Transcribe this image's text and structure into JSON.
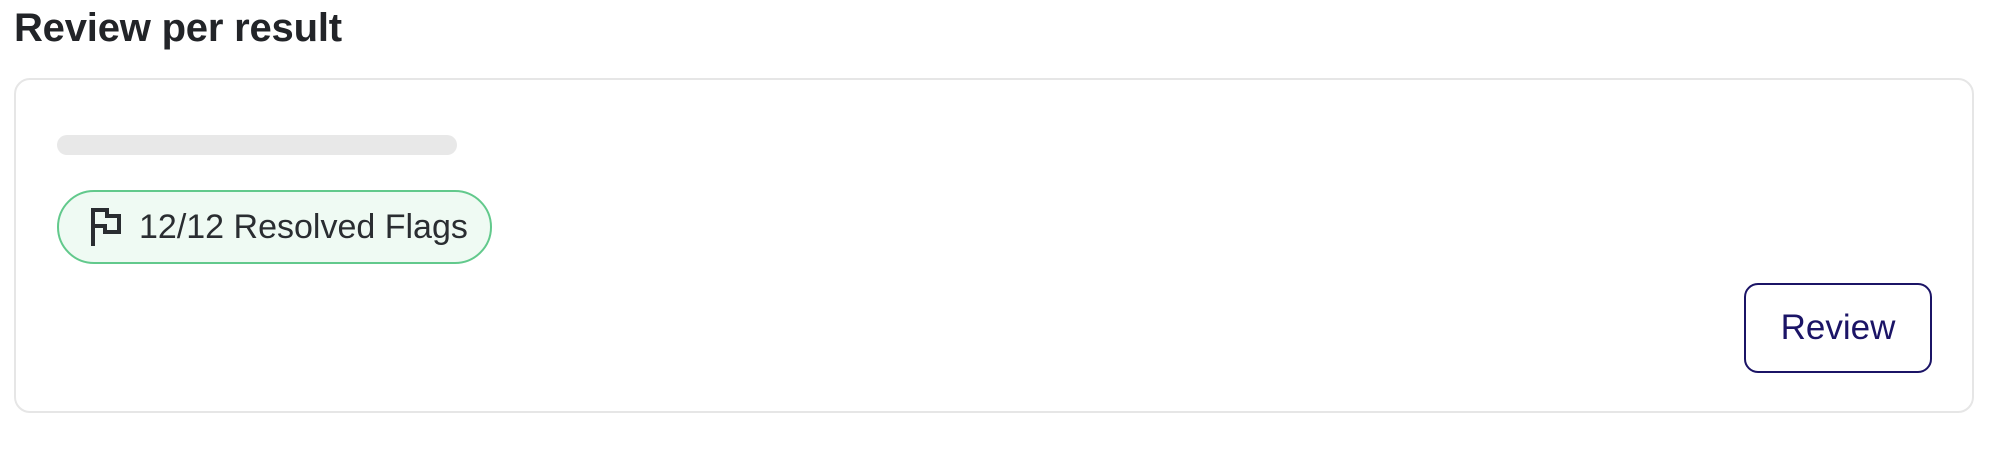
{
  "section": {
    "title": "Review per result"
  },
  "result_card": {
    "flags_badge": {
      "icon": "flag-icon",
      "label": "12/12 Resolved Flags",
      "resolved": 12,
      "total": 12
    },
    "review_button_label": "Review"
  },
  "colors": {
    "title_text": "#222428",
    "card_border": "#e6e6e6",
    "skeleton": "#e8e8e8",
    "badge_border": "#62c98c",
    "badge_background": "#effaf3",
    "button_accent": "#1b1466"
  }
}
